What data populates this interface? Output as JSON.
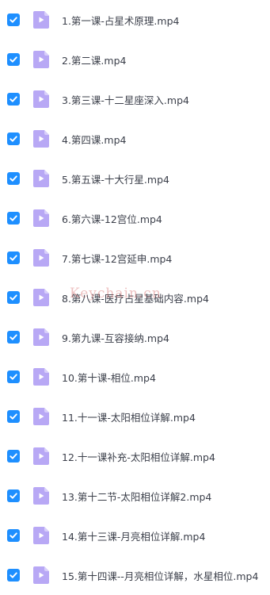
{
  "colors": {
    "checkbox": "#1e8fff",
    "file_icon": "#b8a8f5",
    "file_icon_fold": "#d8cffa",
    "text": "#3b3f4a"
  },
  "icons": {
    "checkbox": "checkmark-icon",
    "file": "video-file-icon"
  },
  "files": [
    {
      "name": "1.第一课-占星术原理.mp4",
      "checked": true
    },
    {
      "name": "2.第二课.mp4",
      "checked": true
    },
    {
      "name": "3.第三课-十二星座深入.mp4",
      "checked": true
    },
    {
      "name": "4.第四课.mp4",
      "checked": true
    },
    {
      "name": "5.第五课-十大行星.mp4",
      "checked": true
    },
    {
      "name": "6.第六课-12宫位.mp4",
      "checked": true
    },
    {
      "name": "7.第七课-12宫延申.mp4",
      "checked": true
    },
    {
      "name": "8.第八课-医疗占星基础内容.mp4",
      "checked": true
    },
    {
      "name": "9.第九课-互容接纳.mp4",
      "checked": true
    },
    {
      "name": "10.第十课-相位.mp4",
      "checked": true
    },
    {
      "name": "11.十一课-太阳相位详解.mp4",
      "checked": true
    },
    {
      "name": "12.十一课补充-太阳相位详解.mp4",
      "checked": true
    },
    {
      "name": "13.第十二节-太阳相位详解2.mp4",
      "checked": true
    },
    {
      "name": "14.第十三课-月亮相位详解.mp4",
      "checked": true
    },
    {
      "name": "15.第十四课--月亮相位详解，水星相位.mp4",
      "checked": true
    }
  ],
  "watermark": "Keychain.cn"
}
